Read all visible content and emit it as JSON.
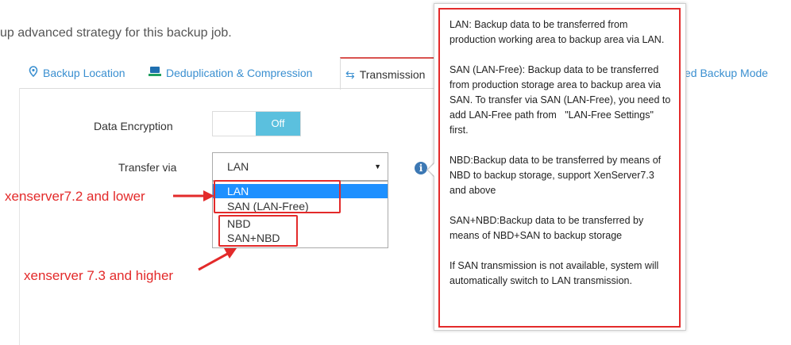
{
  "intro": "up advanced strategy for this backup job.",
  "tabs": [
    {
      "label": "Backup Location"
    },
    {
      "label": "Deduplication & Compression"
    },
    {
      "label": "Transmission"
    },
    {
      "label": "ed Backup Mode"
    }
  ],
  "form": {
    "encryption_label": "Data Encryption",
    "encryption_state": "Off",
    "transfer_label": "Transfer via",
    "transfer_value": "LAN",
    "options": [
      "LAN",
      "SAN (LAN-Free)",
      "NBD",
      "SAN+NBD"
    ]
  },
  "annotations": {
    "lower": "xenserver7.2 and lower",
    "higher": "xenserver 7.3 and higher"
  },
  "tooltip": {
    "p1": "LAN: Backup data to be transferred from production working area to backup area via LAN.",
    "p2": "SAN (LAN-Free): Backup data to be transferred from production storage area to backup area via SAN. To transfer via SAN (LAN-Free), you need to add LAN-Free path from   \"LAN-Free Settings\" first.",
    "p3": "NBD:Backup data to be transferred by means of NBD to backup storage, support XenServer7.3 and above",
    "p4": "SAN+NBD:Backup data to be transferred by means of NBD+SAN to backup storage",
    "p5": "If SAN transmission is not available, system will automatically switch to LAN transmission."
  },
  "colors": {
    "accent": "#3a8fd0",
    "annotation": "#e32a2a",
    "selected": "#1e90ff",
    "toggle_off": "#5bc0de"
  }
}
